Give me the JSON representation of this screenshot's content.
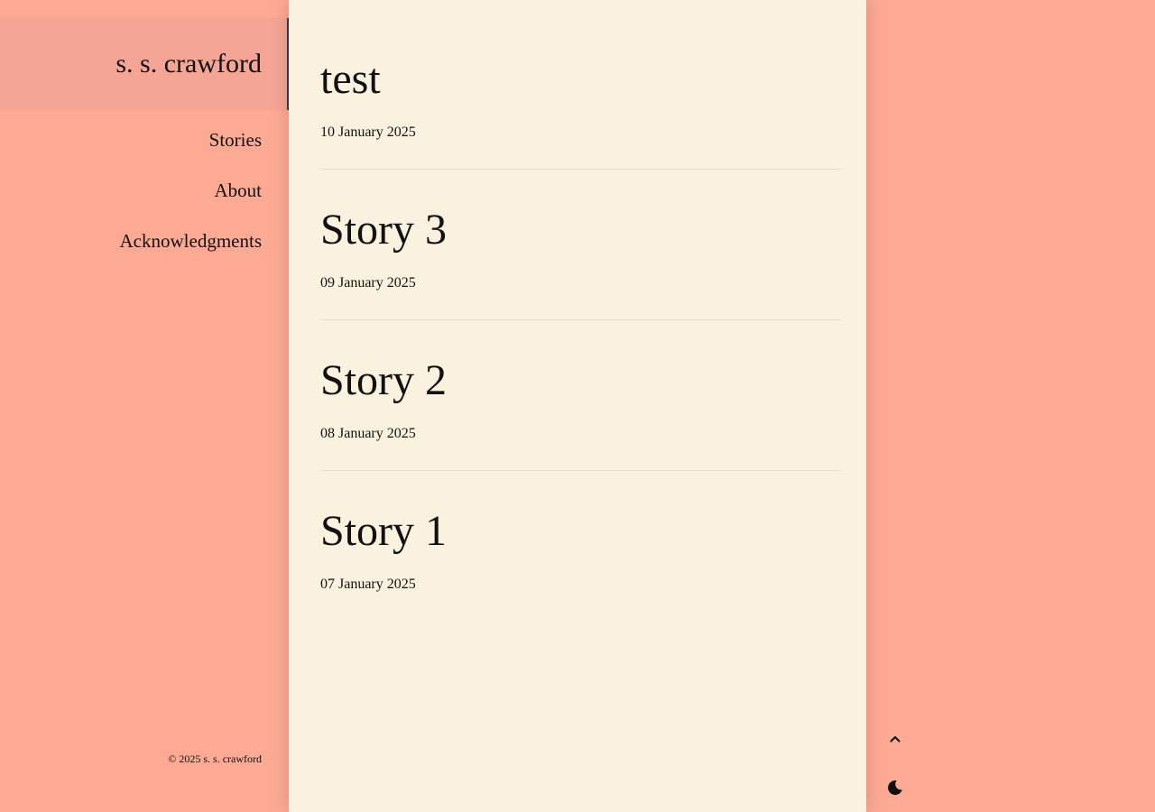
{
  "site": {
    "title": "s. s. crawford"
  },
  "nav": {
    "items": [
      {
        "label": "Stories"
      },
      {
        "label": "About"
      },
      {
        "label": "Acknowledgments"
      }
    ]
  },
  "posts": [
    {
      "title": "test",
      "date": "10 January 2025"
    },
    {
      "title": "Story 3",
      "date": "09 January 2025"
    },
    {
      "title": "Story 2",
      "date": "08 January 2025"
    },
    {
      "title": "Story 1",
      "date": "07 January 2025"
    }
  ],
  "footer": {
    "copyright": "© 2025 s. s. crawford"
  },
  "controls": {
    "scroll_top_icon": "chevron-up-icon",
    "theme_toggle_icon": "moon-icon"
  },
  "colors": {
    "page_background": "#fdaa94",
    "content_background": "#faf1df",
    "title_box_background": "#f4a595",
    "accent_border": "#1f3b57"
  }
}
